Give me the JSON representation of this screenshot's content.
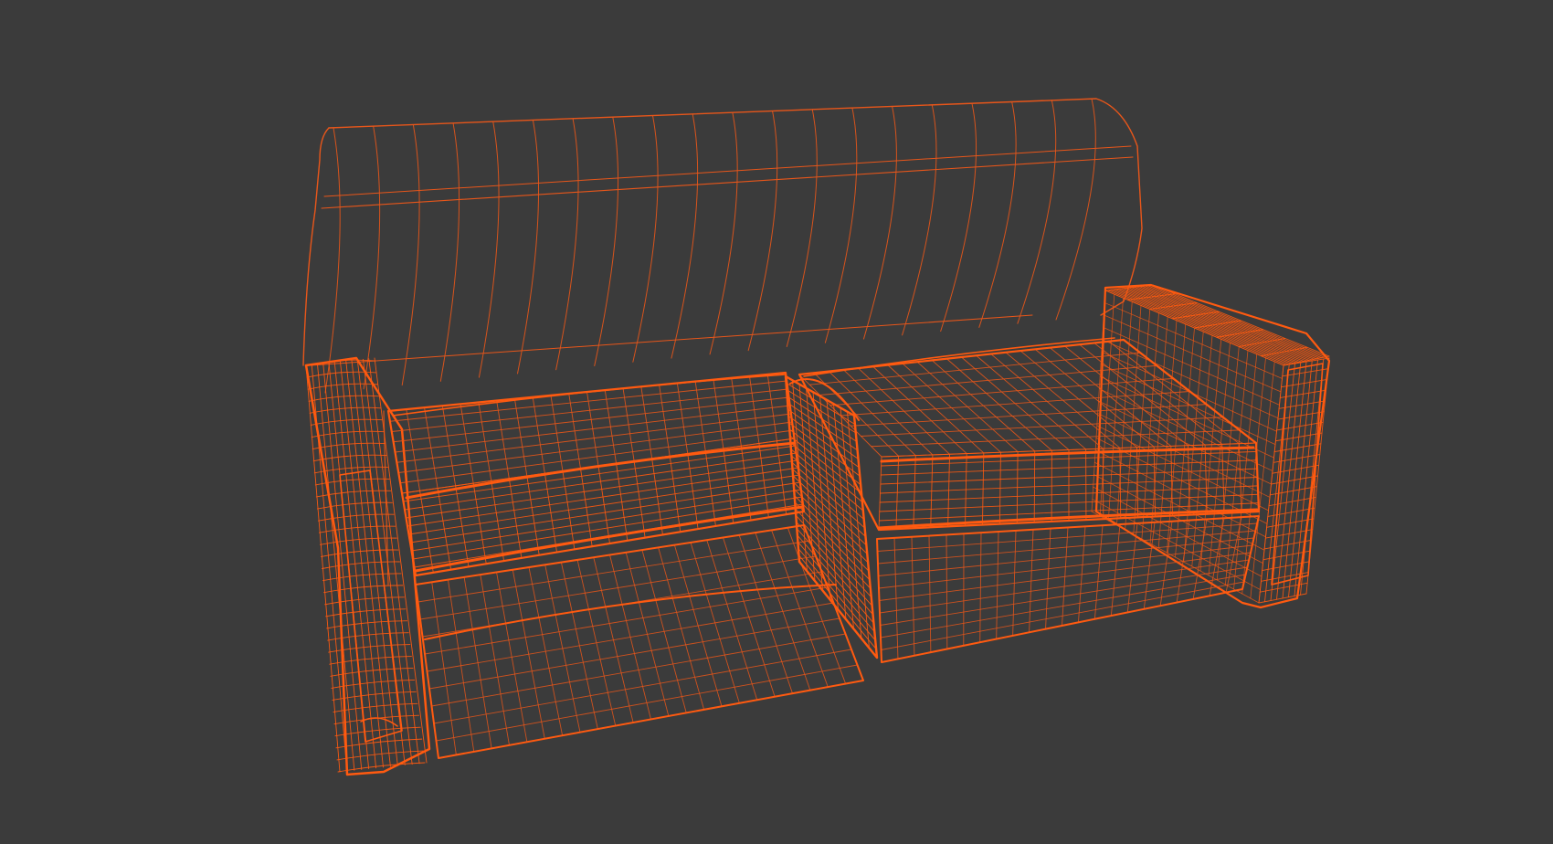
{
  "viewport": {
    "background": "#3b3b3b",
    "wire_color": "#e8561a",
    "wire_color_dense": "#ff5a10",
    "subject": "sofa-wireframe"
  }
}
